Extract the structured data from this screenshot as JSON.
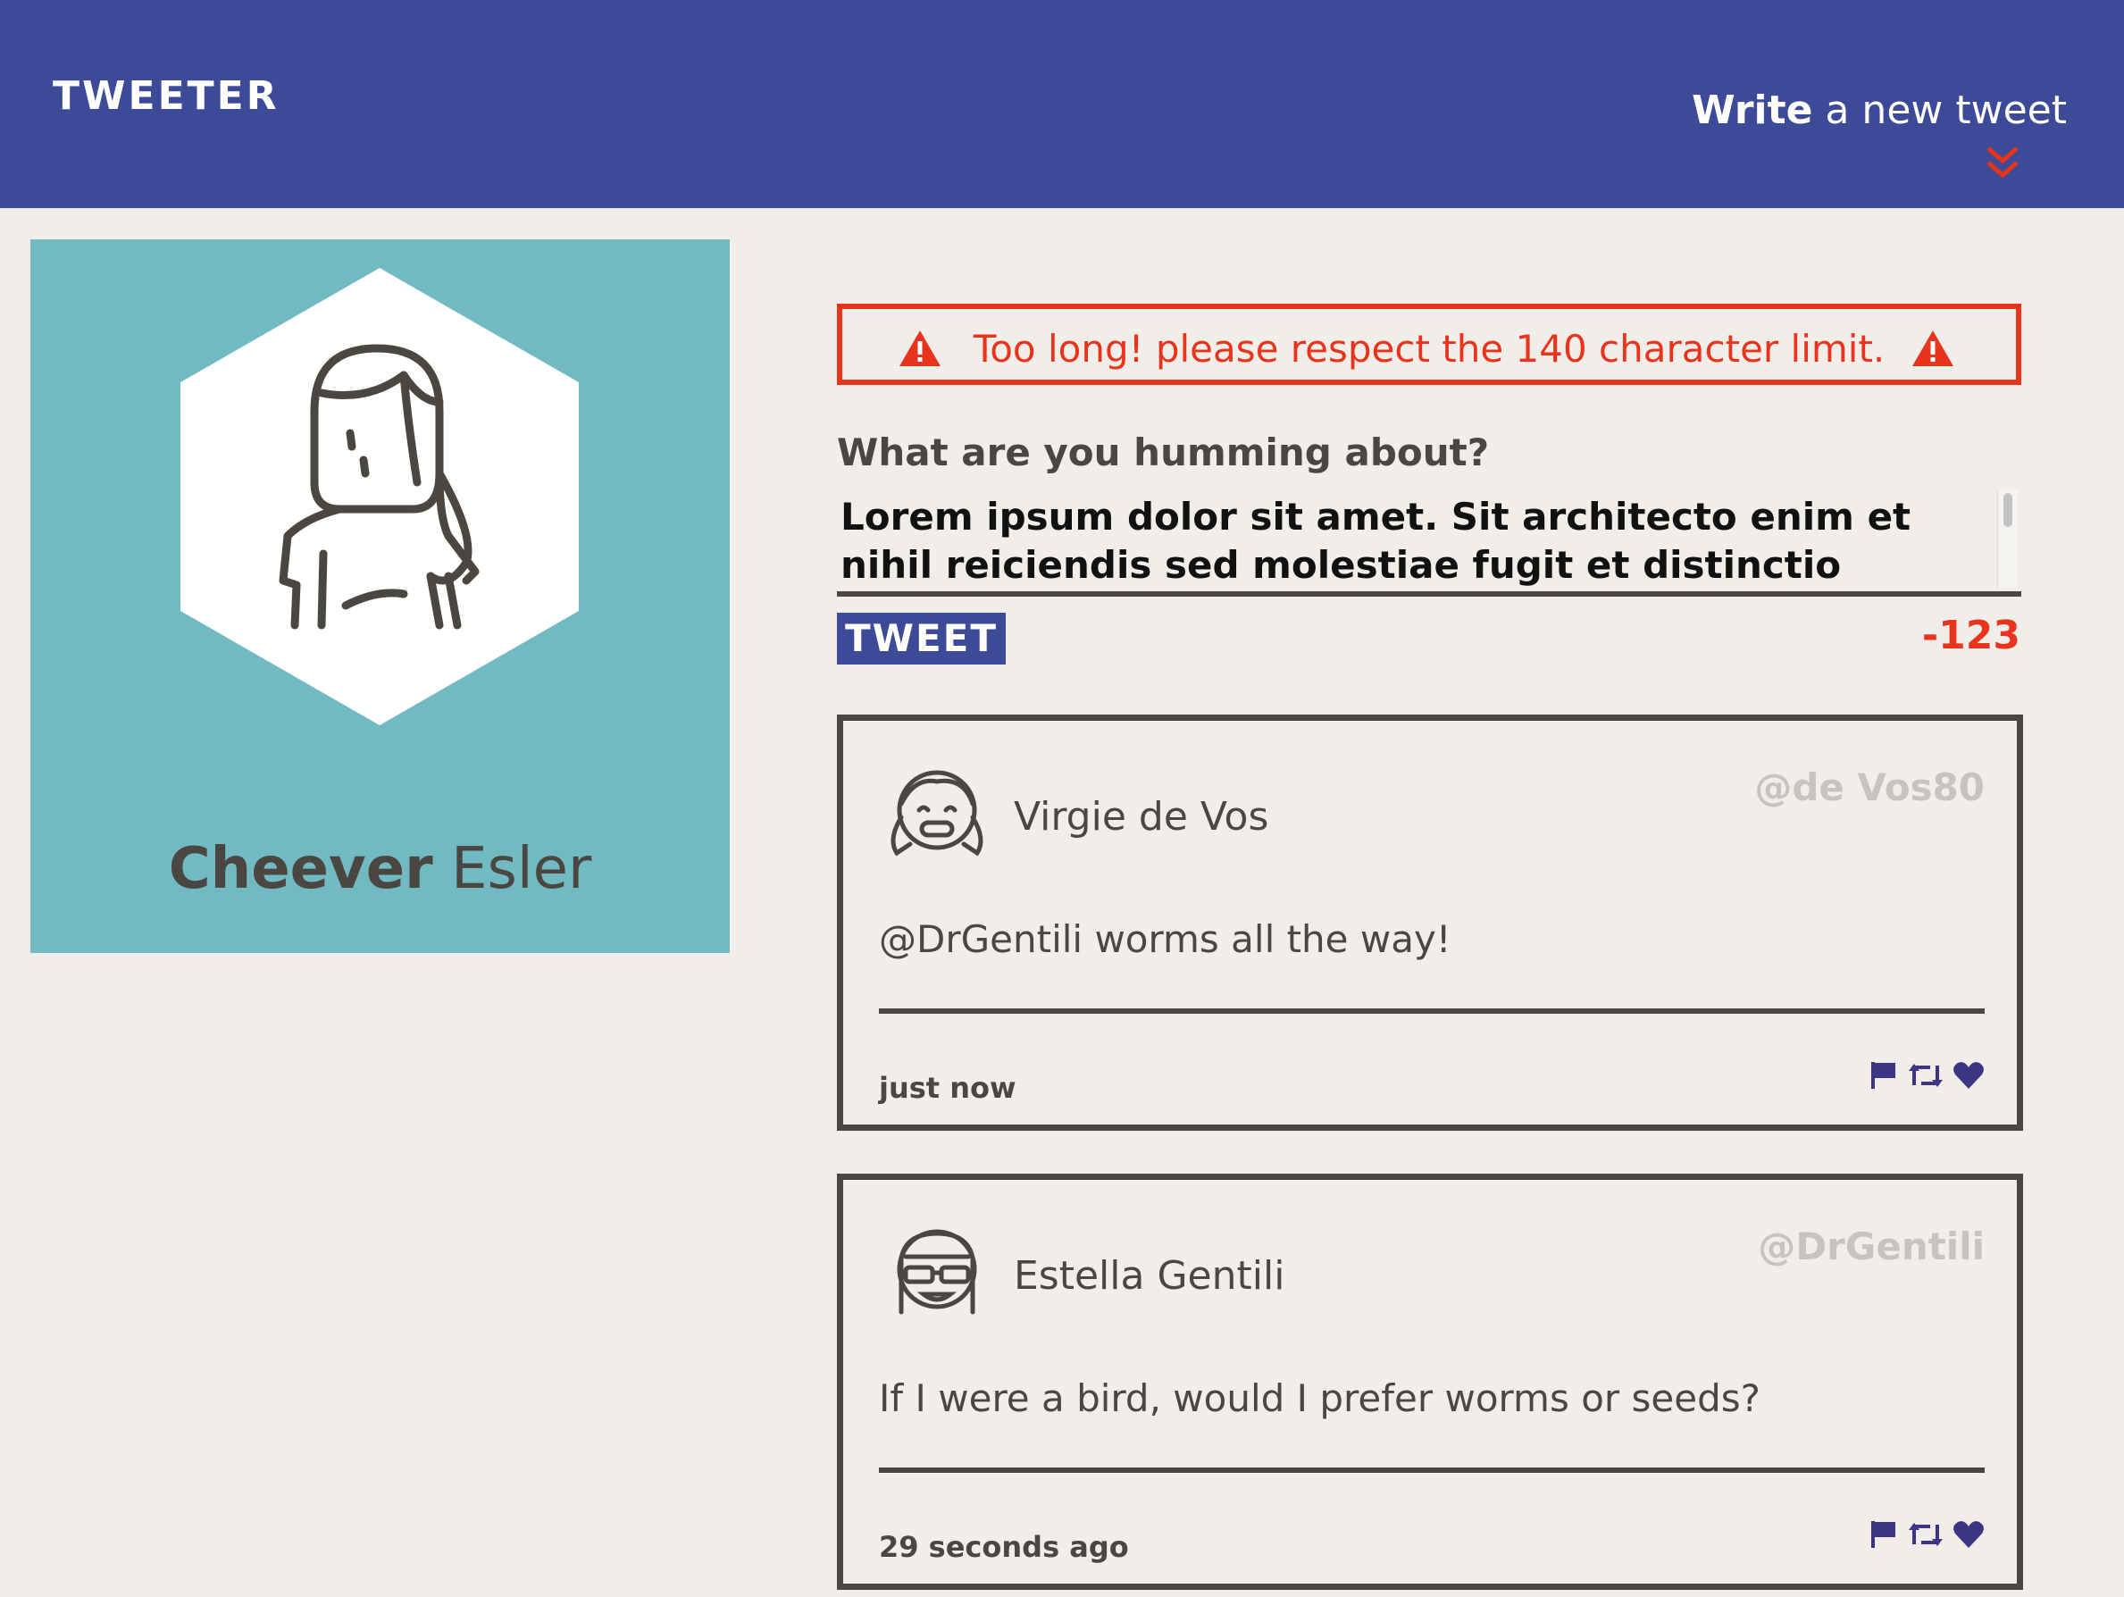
{
  "nav": {
    "brand": "TWEETER",
    "compose_strong": "Write",
    "compose_rest": " a new tweet",
    "chevron_icon": "double-chevron-down-icon"
  },
  "profile": {
    "first_name": "Cheever",
    "last_name": " Esler",
    "avatar_icon": "female-avatar-icon"
  },
  "composer": {
    "error_message": "Too long! please respect the 140 character limit.",
    "label": "What are you humming about?",
    "text": "Lorem ipsum dolor sit amet. Sit architecto enim et nihil reiciendis sed molestiae fugit et distinctio quidem et",
    "button_label": "TWEET",
    "counter": "-123"
  },
  "tweets": [
    {
      "name": "Virgie de Vos",
      "handle": "@de Vos80",
      "content": "@DrGentili worms all the way!",
      "time": "just now"
    },
    {
      "name": "Estella Gentili",
      "handle": "@DrGentili",
      "content": "If I were a bird, would I prefer worms or seeds?",
      "time": "29 seconds ago"
    }
  ],
  "colors": {
    "nav": "#3d4a97",
    "background": "#f1eee9",
    "profile_bg": "#71bac1",
    "error": "#e8341c",
    "text": "#4a4641"
  }
}
